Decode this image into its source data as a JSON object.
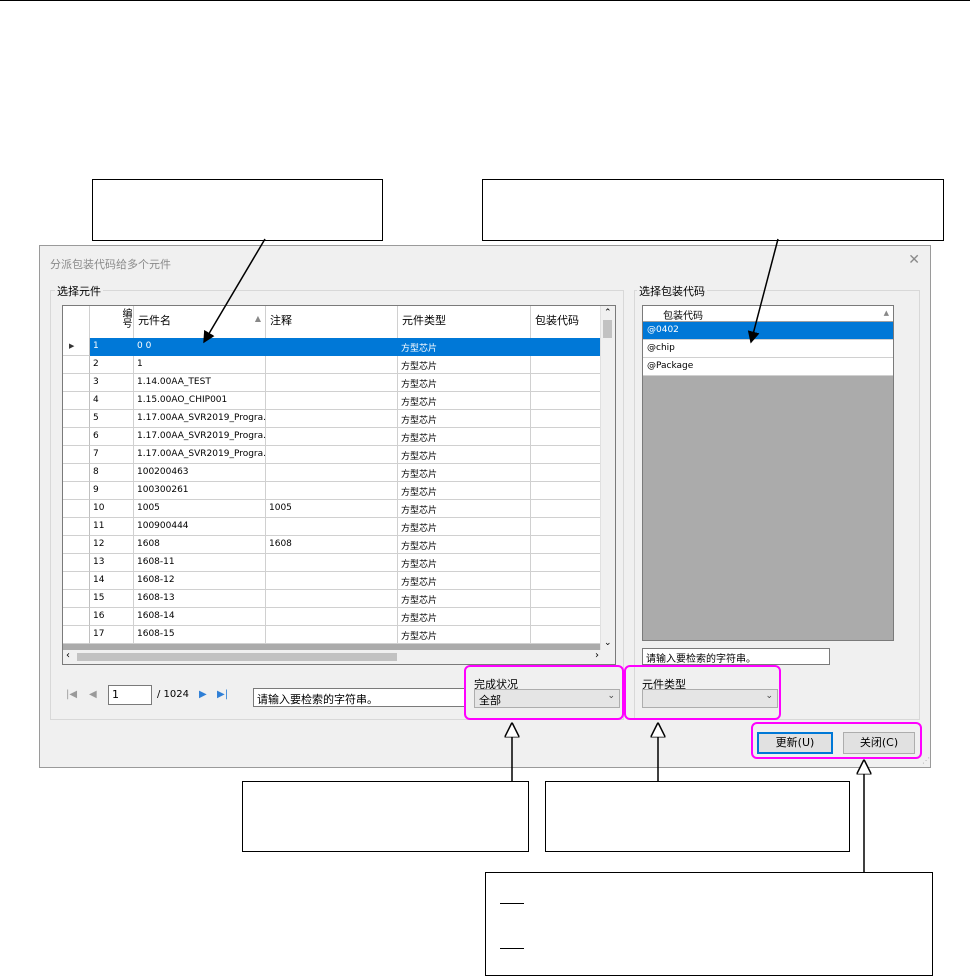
{
  "dialog": {
    "title": "分派包装代码给多个元件",
    "close_glyph": "✕",
    "select_parts_group": "选择元件",
    "select_pkg_group": "选择包装代码"
  },
  "grid": {
    "columns": [
      "编号",
      "元件名",
      "注释",
      "元件类型",
      "包装代码"
    ],
    "rows": [
      {
        "no": "1",
        "name": "0 0",
        "note": "",
        "type": "方型芯片",
        "pkg": ""
      },
      {
        "no": "2",
        "name": "1",
        "note": "",
        "type": "方型芯片",
        "pkg": ""
      },
      {
        "no": "3",
        "name": "1.14.00AA_TEST",
        "note": "",
        "type": "方型芯片",
        "pkg": ""
      },
      {
        "no": "4",
        "name": "1.15.00AO_CHIP001",
        "note": "",
        "type": "方型芯片",
        "pkg": ""
      },
      {
        "no": "5",
        "name": "1.17.00AA_SVR2019_Progra...",
        "note": "",
        "type": "方型芯片",
        "pkg": ""
      },
      {
        "no": "6",
        "name": "1.17.00AA_SVR2019_Progra...",
        "note": "",
        "type": "方型芯片",
        "pkg": ""
      },
      {
        "no": "7",
        "name": "1.17.00AA_SVR2019_Progra...",
        "note": "",
        "type": "方型芯片",
        "pkg": ""
      },
      {
        "no": "8",
        "name": "100200463",
        "note": "",
        "type": "方型芯片",
        "pkg": ""
      },
      {
        "no": "9",
        "name": "100300261",
        "note": "",
        "type": "方型芯片",
        "pkg": ""
      },
      {
        "no": "10",
        "name": "1005",
        "note": "1005",
        "type": "方型芯片",
        "pkg": ""
      },
      {
        "no": "11",
        "name": "100900444",
        "note": "",
        "type": "方型芯片",
        "pkg": ""
      },
      {
        "no": "12",
        "name": "1608",
        "note": "1608",
        "type": "方型芯片",
        "pkg": ""
      },
      {
        "no": "13",
        "name": "1608-11",
        "note": "",
        "type": "方型芯片",
        "pkg": ""
      },
      {
        "no": "14",
        "name": "1608-12",
        "note": "",
        "type": "方型芯片",
        "pkg": ""
      },
      {
        "no": "15",
        "name": "1608-13",
        "note": "",
        "type": "方型芯片",
        "pkg": ""
      },
      {
        "no": "16",
        "name": "1608-14",
        "note": "",
        "type": "方型芯片",
        "pkg": ""
      },
      {
        "no": "17",
        "name": "1608-15",
        "note": "",
        "type": "方型芯片",
        "pkg": ""
      }
    ]
  },
  "pager": {
    "current": "1",
    "total": "/ 1024",
    "search_placeholder": "请输入要检索的字符串。"
  },
  "status_filter": {
    "label": "完成状况",
    "value": "全部"
  },
  "type_filter": {
    "label": "元件类型",
    "value": ""
  },
  "pkg_panel": {
    "header": "包装代码",
    "items": [
      "@0402",
      "@chip",
      "@Package"
    ],
    "search_placeholder": "请输入要检索的字符串。"
  },
  "buttons": {
    "update": "更新(U)",
    "close": "关闭(C)"
  },
  "colors": {
    "highlight": "#ff00ff",
    "selection": "#0078d7"
  }
}
